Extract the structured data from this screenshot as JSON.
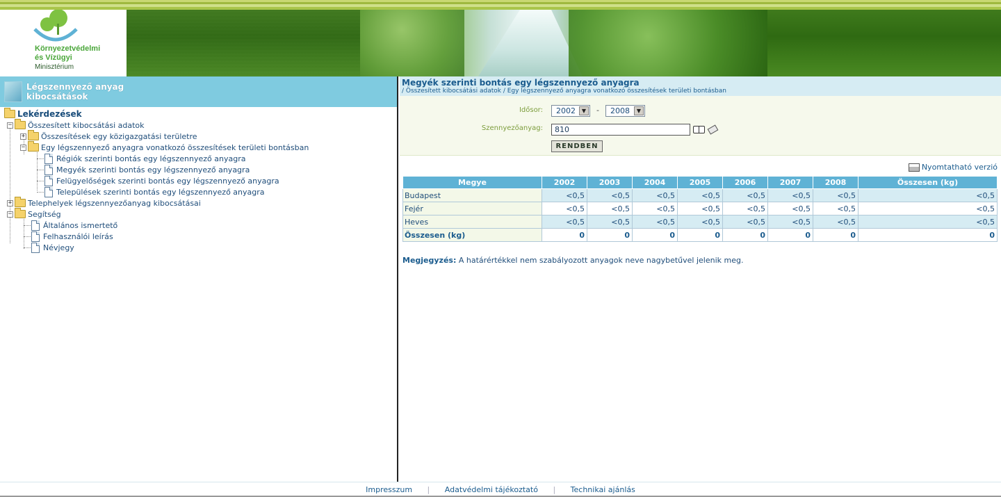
{
  "logo": {
    "line1": "Környezetvédelmi",
    "line2": "és Vízügyi",
    "line3": "Minisztérium"
  },
  "sidebar": {
    "title_line1": "Légszennyező anyag",
    "title_line2": "kibocsátások",
    "tree": {
      "root": "Lekérdezések",
      "n1": "Összesített kibocsátási adatok",
      "n1_1": "Összesítések egy közigazgatási területre",
      "n1_2": "Egy légszennyező anyagra vonatkozó összesítések területi bontásban",
      "n1_2_1": "Régiók szerinti bontás egy légszennyező anyagra",
      "n1_2_2": "Megyék szerinti bontás egy légszennyező anyagra",
      "n1_2_3": "Felügyelőségek szerinti bontás egy légszennyező anyagra",
      "n1_2_4": "Települések szerinti bontás egy légszennyező anyagra",
      "n2": "Telephelyek légszennyezőanyag kibocsátásai",
      "n3": "Segítség",
      "n3_1": "Általános ismertető",
      "n3_2": "Felhasználói leírás",
      "n3_3": "Névjegy"
    }
  },
  "main": {
    "title": "Megyék szerinti bontás egy légszennyező anyagra",
    "breadcrumb": "/ Összesített kibocsátási adatok / Egy légszennyező anyagra vonatkozó összesítések területi bontásban",
    "form": {
      "idosor_label": "Idősor:",
      "year_from": "2002",
      "dash": "-",
      "year_to": "2008",
      "pollutant_label": "Szennyezőanyag:",
      "pollutant_value": "810",
      "submit": "RENDBEN"
    },
    "print_link": "Nyomtatható verzió",
    "table": {
      "headers": [
        "Megye",
        "2002",
        "2003",
        "2004",
        "2005",
        "2006",
        "2007",
        "2008",
        "Összesen (kg)"
      ],
      "rows": [
        [
          "Budapest",
          "<0,5",
          "<0,5",
          "<0,5",
          "<0,5",
          "<0,5",
          "<0,5",
          "<0,5",
          "<0,5"
        ],
        [
          "Fejér",
          "<0,5",
          "<0,5",
          "<0,5",
          "<0,5",
          "<0,5",
          "<0,5",
          "<0,5",
          "<0,5"
        ],
        [
          "Heves",
          "<0,5",
          "<0,5",
          "<0,5",
          "<0,5",
          "<0,5",
          "<0,5",
          "<0,5",
          "<0,5"
        ],
        [
          "Összesen (kg)",
          "0",
          "0",
          "0",
          "0",
          "0",
          "0",
          "0",
          "0"
        ]
      ]
    },
    "note_label": "Megjegyzés:",
    "note_text": " A határértékkel nem szabályozott anyagok neve nagybetűvel jelenik meg."
  },
  "footer": {
    "links": [
      "Impresszum",
      "Adatvédelmi tájékoztató",
      "Technikai ajánlás"
    ],
    "separator": "|"
  },
  "colors": {
    "header_green": "#3f7a1c",
    "sidebar_header": "#7fcbe0",
    "table_header": "#5fb2d5",
    "link_blue": "#1b5c8e",
    "label_green": "#7c9d3c"
  }
}
